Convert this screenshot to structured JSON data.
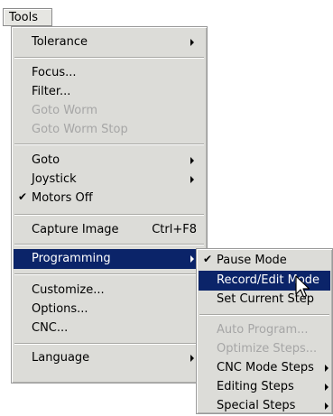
{
  "menubar": {
    "tools_label": "Tools"
  },
  "main_menu": {
    "tolerance": "Tolerance",
    "focus": "Focus...",
    "filter": "Filter...",
    "goto_worm": "Goto Worm",
    "goto_worm_stop": "Goto Worm Stop",
    "goto": "Goto",
    "joystick": "Joystick",
    "motors_off": "Motors Off",
    "capture_image": "Capture Image",
    "capture_shortcut": "Ctrl+F8",
    "programming": "Programming",
    "customize": "Customize...",
    "options": "Options...",
    "cnc": "CNC...",
    "language": "Language"
  },
  "sub_menu": {
    "pause_mode": "Pause Mode",
    "record_edit_mode": "Record/Edit Mode",
    "set_current_step": "Set Current Step",
    "auto_program": "Auto Program...",
    "optimize_steps": "Optimize Steps...",
    "cnc_mode_steps": "CNC Mode Steps",
    "editing_steps": "Editing Steps",
    "special_steps": "Special Steps"
  },
  "icons": {
    "check": "checkmark-icon",
    "submenu_arrow": "submenu-arrow-icon",
    "cursor": "mouse-pointer-icon"
  },
  "colors": {
    "highlight": "#0b2469",
    "menu_bg": "#dcdcd8",
    "disabled_text": "#a6a6a6"
  }
}
